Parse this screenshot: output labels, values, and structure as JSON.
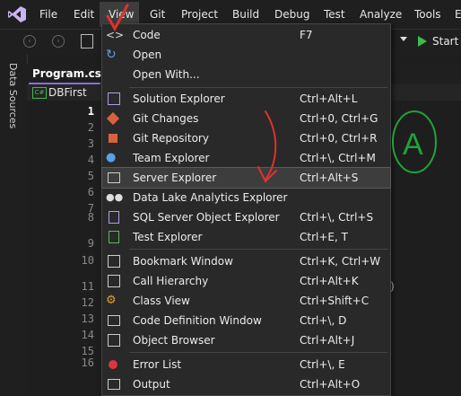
{
  "menubar": {
    "items": [
      "File",
      "Edit",
      "View",
      "Git",
      "Project",
      "Build",
      "Debug",
      "Test",
      "Analyze",
      "Tools",
      "E"
    ]
  },
  "toolbar": {
    "start_label": "Start"
  },
  "left_rail": {
    "label": "Data Sources"
  },
  "editor": {
    "tab_label": "Program.cs",
    "nav_label": "DBFirst",
    "line_numbers": [
      "1",
      "2",
      "3",
      "4",
      "5",
      "6",
      "7",
      "8",
      "9",
      "10",
      "11",
      "12",
      "13",
      "14",
      "15",
      "16"
    ],
    "fragment_paren": ")"
  },
  "view_menu": {
    "items": [
      {
        "icon": "code-icon",
        "label": "Code",
        "shortcut": "F7"
      },
      {
        "icon": "open-icon",
        "label": "Open",
        "shortcut": ""
      },
      {
        "icon": "",
        "label": "Open With...",
        "shortcut": ""
      },
      {
        "icon": "solution-explorer-icon",
        "label": "Solution Explorer",
        "shortcut": "Ctrl+Alt+L"
      },
      {
        "icon": "git-changes-icon",
        "label": "Git Changes",
        "shortcut": "Ctrl+0, Ctrl+G"
      },
      {
        "icon": "git-repository-icon",
        "label": "Git Repository",
        "shortcut": "Ctrl+0, Ctrl+R"
      },
      {
        "icon": "team-explorer-icon",
        "label": "Team Explorer",
        "shortcut": "Ctrl+\\, Ctrl+M"
      },
      {
        "icon": "server-explorer-icon",
        "label": "Server Explorer",
        "shortcut": "Ctrl+Alt+S"
      },
      {
        "icon": "data-lake-icon",
        "label": "Data Lake Analytics Explorer",
        "shortcut": ""
      },
      {
        "icon": "sql-server-icon",
        "label": "SQL Server Object Explorer",
        "shortcut": "Ctrl+\\, Ctrl+S"
      },
      {
        "icon": "test-explorer-icon",
        "label": "Test Explorer",
        "shortcut": "Ctrl+E, T"
      },
      {
        "icon": "bookmark-icon",
        "label": "Bookmark Window",
        "shortcut": "Ctrl+K, Ctrl+W"
      },
      {
        "icon": "call-hierarchy-icon",
        "label": "Call Hierarchy",
        "shortcut": "Ctrl+Alt+K"
      },
      {
        "icon": "class-view-icon",
        "label": "Class View",
        "shortcut": "Ctrl+Shift+C"
      },
      {
        "icon": "code-definition-icon",
        "label": "Code Definition Window",
        "shortcut": "Ctrl+\\, D"
      },
      {
        "icon": "object-browser-icon",
        "label": "Object Browser",
        "shortcut": "Ctrl+Alt+J"
      },
      {
        "icon": "error-list-icon",
        "label": "Error List",
        "shortcut": "Ctrl+\\, E"
      },
      {
        "icon": "output-icon",
        "label": "Output",
        "shortcut": "Ctrl+Alt+O"
      }
    ],
    "highlighted_label": "Server Explorer"
  },
  "annotations": {
    "circled_letter": "A"
  },
  "colors": {
    "accent": "#8b6fd6",
    "annotation_red": "#e0322c",
    "annotation_green": "#1fa33a"
  }
}
